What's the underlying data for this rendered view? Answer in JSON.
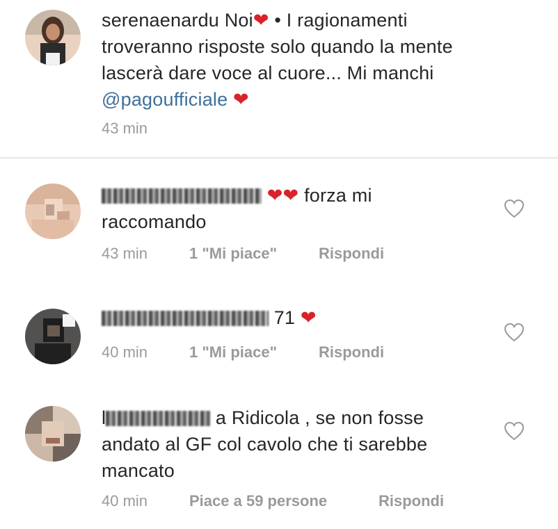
{
  "post": {
    "username": "serenaenardu",
    "text_part1": "Noi",
    "text_part2": "• I ragionamenti",
    "line2": "troveranno risposte solo quando la mente",
    "line3": "lascerà dare voce al cuore... Mi manchi",
    "mention": "@pagoufficiale",
    "time": "43 min"
  },
  "comments": [
    {
      "username_visible": "",
      "line1": "forza mi",
      "line2": "raccomando",
      "time": "43 min",
      "likes": "1 \"Mi piace\"",
      "reply": "Rispondi"
    },
    {
      "username_visible": "71",
      "time": "40 min",
      "likes": "1 \"Mi piace\"",
      "reply": "Rispondi"
    },
    {
      "username_visible": "l",
      "line1": "a Ridicola , se non fosse",
      "line2": "andato al GF col cavolo che ti sarebbe",
      "line3": "mancato",
      "time": "40 min",
      "likes": "Piace a 59 persone",
      "reply": "Rispondi"
    }
  ],
  "icons": {
    "heart": "heart-emoji-icon",
    "like": "heart-outline-icon"
  },
  "colors": {
    "heart": "#d8232a",
    "mention": "#3f6f9a",
    "meta": "#9a9a9a"
  }
}
